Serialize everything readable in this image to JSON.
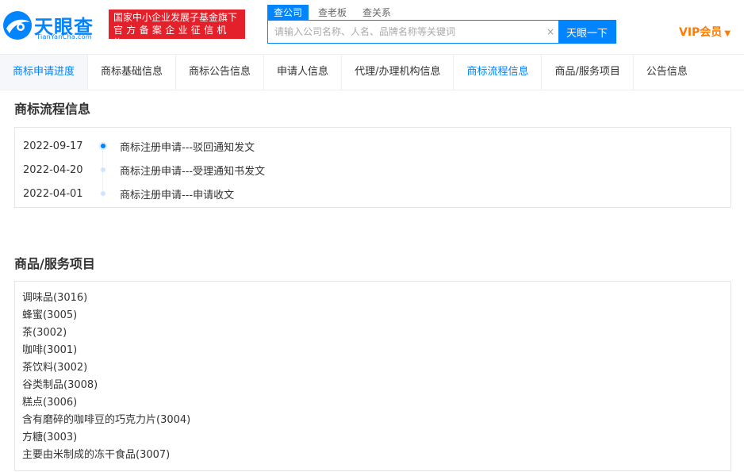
{
  "header": {
    "logo_text": "天眼查",
    "logo_sub": "TianYanCha.com",
    "badge_line1": "国家中小企业发展子基金旗下",
    "badge_line2": "官方备案企业征信机构",
    "search_tabs": [
      "查公司",
      "查老板",
      "查关系"
    ],
    "search_placeholder": "请输入公司名称、人名、品牌名称等关键词",
    "clear_icon": "×",
    "search_button": "天眼一下",
    "vip_label": "VIP会员",
    "vip_caret": "▼",
    "colors": {
      "brand": "#0084ff",
      "badge": "#e4202a",
      "vip": "#ff7a00"
    }
  },
  "tabs": [
    "商标申请进度",
    "商标基础信息",
    "商标公告信息",
    "申请人信息",
    "代理/办理机构信息",
    "商标流程信息",
    "商品/服务项目",
    "公告信息"
  ],
  "flow": {
    "title": "商标流程信息",
    "items": [
      {
        "date": "2022-09-17",
        "text": "商标注册申请---驳回通知发文"
      },
      {
        "date": "2022-04-20",
        "text": "商标注册申请---受理通知书发文"
      },
      {
        "date": "2022-04-01",
        "text": "商标注册申请---申请收文"
      }
    ]
  },
  "goods": {
    "title": "商品/服务项目",
    "items": [
      "调味品(3016)",
      "蜂蜜(3005)",
      "茶(3002)",
      "咖啡(3001)",
      "茶饮料(3002)",
      "谷类制品(3008)",
      "糕点(3006)",
      "含有磨碎的咖啡豆的巧克力片(3004)",
      "方糖(3003)",
      "主要由米制成的冻干食品(3007)"
    ]
  }
}
